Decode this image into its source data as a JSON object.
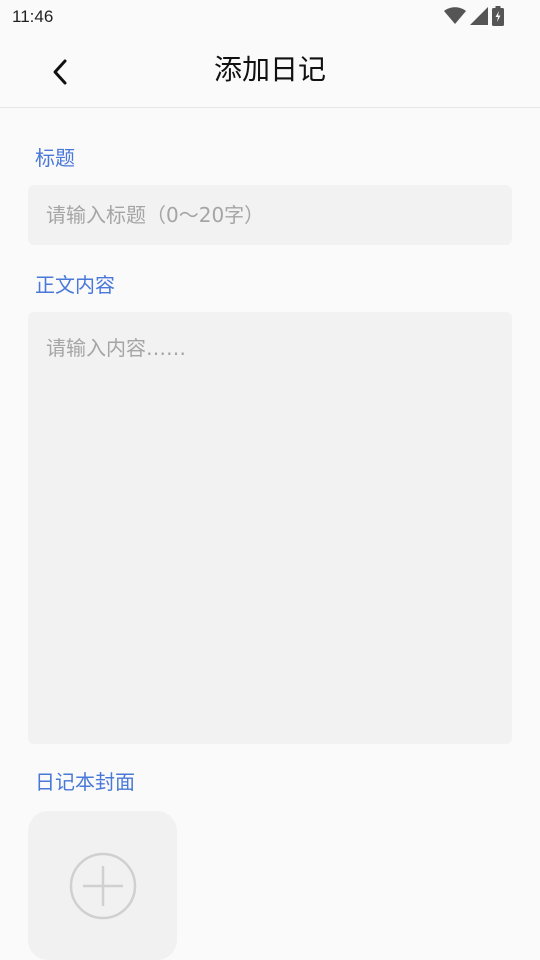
{
  "status_bar": {
    "time": "11:46",
    "icons": [
      "wifi-icon",
      "signal-icon",
      "battery-charging-icon"
    ]
  },
  "app_bar": {
    "back_icon": "chevron-left-icon",
    "title": "添加日记"
  },
  "form": {
    "title_label": "标题",
    "title_placeholder": "请输入标题（0～20字）",
    "title_value": "",
    "content_label": "正文内容",
    "content_placeholder": "请输入内容……",
    "content_value": "",
    "cover_label": "日记本封面",
    "cover_add_icon": "plus-circle-icon"
  },
  "colors": {
    "accent": "#4a78d8",
    "background": "#fafafa",
    "field": "#f2f2f2",
    "placeholder": "#a5a5a5"
  }
}
